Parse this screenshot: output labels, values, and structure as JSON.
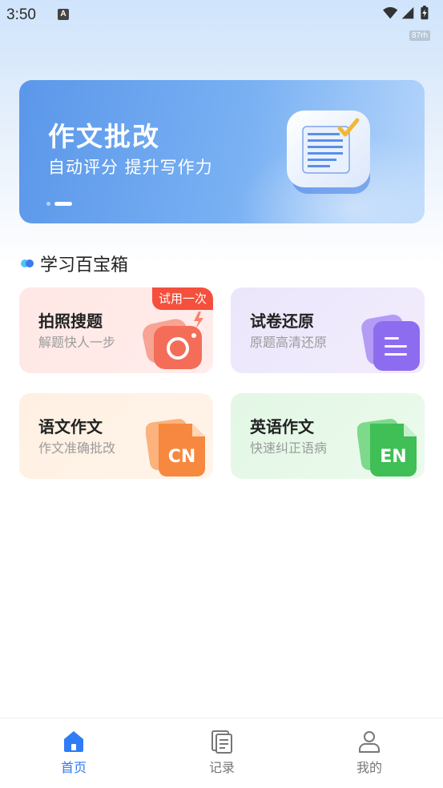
{
  "status_bar": {
    "time": "3:50",
    "notification_icon": "A",
    "speed": "87rh"
  },
  "banner": {
    "title": "作文批改",
    "subtitle": "自动评分 提升写作力",
    "icon": "document-check-icon"
  },
  "section": {
    "title": "学习百宝箱"
  },
  "tools": [
    {
      "title": "拍照搜题",
      "subtitle": "解题快人一步",
      "badge": "试用一次",
      "icon": "camera-icon",
      "accent": "#f46d58"
    },
    {
      "title": "试卷还原",
      "subtitle": "原题高清还原",
      "icon": "paper-restore-icon",
      "accent": "#8d6cf0"
    },
    {
      "title": "语文作文",
      "subtitle": "作文准确批改",
      "icon": "cn-document-icon",
      "accent": "#f7883f"
    },
    {
      "title": "英语作文",
      "subtitle": "快速纠正语病",
      "icon": "en-document-icon",
      "accent": "#3fbf55"
    }
  ],
  "cn_icon_text": "CN",
  "en_icon_text": "EN",
  "bottom_nav": [
    {
      "label": "首页",
      "icon": "home-icon",
      "active": true
    },
    {
      "label": "记录",
      "icon": "records-icon",
      "active": false
    },
    {
      "label": "我的",
      "icon": "profile-icon",
      "active": false
    }
  ],
  "colors": {
    "accent": "#2f7cf6",
    "badge": "#f4503d"
  }
}
